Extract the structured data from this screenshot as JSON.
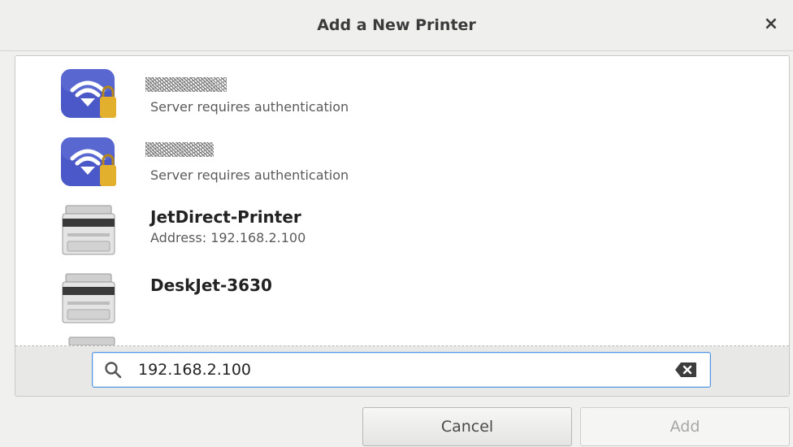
{
  "dialog": {
    "title": "Add a New Printer",
    "close_symbol": "×"
  },
  "printers": [
    {
      "name": "",
      "subtitle": "Server requires authentication",
      "icon": "network-printer-locked-icon"
    },
    {
      "name": "",
      "subtitle": "Server requires authentication",
      "icon": "network-printer-locked-icon"
    },
    {
      "name": "JetDirect-Printer",
      "subtitle": "Address: 192.168.2.100",
      "icon": "printer-icon"
    },
    {
      "name": "DeskJet-3630",
      "subtitle": "",
      "icon": "printer-icon"
    }
  ],
  "search": {
    "value": "192.168.2.100",
    "icon": "search-icon",
    "clear_icon": "clear-text-icon"
  },
  "buttons": {
    "cancel": "Cancel",
    "add": "Add"
  },
  "colors": {
    "accent": "#5294e2",
    "network_icon_blue": "#4a58c8",
    "lock_gold": "#e2b02c"
  }
}
